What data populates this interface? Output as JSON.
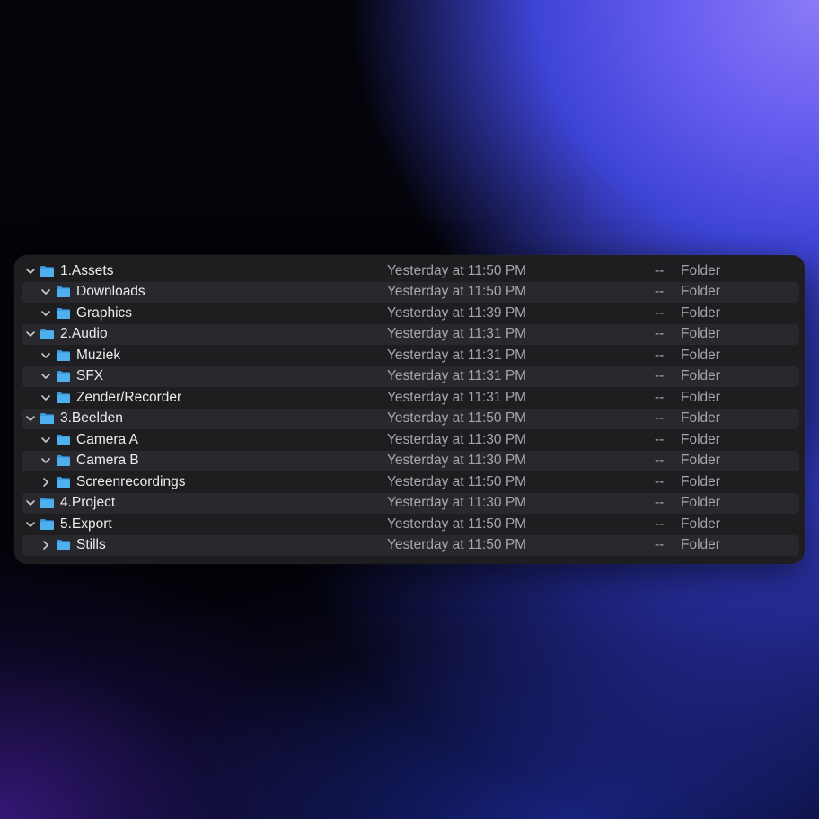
{
  "colors": {
    "folder_icon": "#4fb0f0",
    "folder_tab": "#3a97dc",
    "window_bg": "#1e1e21",
    "alt_row_bg": "#29292d"
  },
  "rows": [
    {
      "name": "1.Assets",
      "date": "Yesterday at 11:50 PM",
      "size": "--",
      "kind": "Folder",
      "level": 0,
      "expanded": true
    },
    {
      "name": "Downloads",
      "date": "Yesterday at 11:50 PM",
      "size": "--",
      "kind": "Folder",
      "level": 1,
      "expanded": true
    },
    {
      "name": "Graphics",
      "date": "Yesterday at 11:39 PM",
      "size": "--",
      "kind": "Folder",
      "level": 1,
      "expanded": true
    },
    {
      "name": "2.Audio",
      "date": "Yesterday at 11:31 PM",
      "size": "--",
      "kind": "Folder",
      "level": 0,
      "expanded": true
    },
    {
      "name": "Muziek",
      "date": "Yesterday at 11:31 PM",
      "size": "--",
      "kind": "Folder",
      "level": 1,
      "expanded": true
    },
    {
      "name": "SFX",
      "date": "Yesterday at 11:31 PM",
      "size": "--",
      "kind": "Folder",
      "level": 1,
      "expanded": true
    },
    {
      "name": "Zender/Recorder",
      "date": "Yesterday at 11:31 PM",
      "size": "--",
      "kind": "Folder",
      "level": 1,
      "expanded": true
    },
    {
      "name": "3.Beelden",
      "date": "Yesterday at 11:50 PM",
      "size": "--",
      "kind": "Folder",
      "level": 0,
      "expanded": true
    },
    {
      "name": "Camera A",
      "date": "Yesterday at 11:30 PM",
      "size": "--",
      "kind": "Folder",
      "level": 1,
      "expanded": true
    },
    {
      "name": "Camera B",
      "date": "Yesterday at 11:30 PM",
      "size": "--",
      "kind": "Folder",
      "level": 1,
      "expanded": true
    },
    {
      "name": "Screenrecordings",
      "date": "Yesterday at 11:50 PM",
      "size": "--",
      "kind": "Folder",
      "level": 1,
      "expanded": false
    },
    {
      "name": "4.Project",
      "date": "Yesterday at 11:30 PM",
      "size": "--",
      "kind": "Folder",
      "level": 0,
      "expanded": true
    },
    {
      "name": "5.Export",
      "date": "Yesterday at 11:50 PM",
      "size": "--",
      "kind": "Folder",
      "level": 0,
      "expanded": true
    },
    {
      "name": "Stills",
      "date": "Yesterday at 11:50 PM",
      "size": "--",
      "kind": "Folder",
      "level": 1,
      "expanded": false
    }
  ]
}
